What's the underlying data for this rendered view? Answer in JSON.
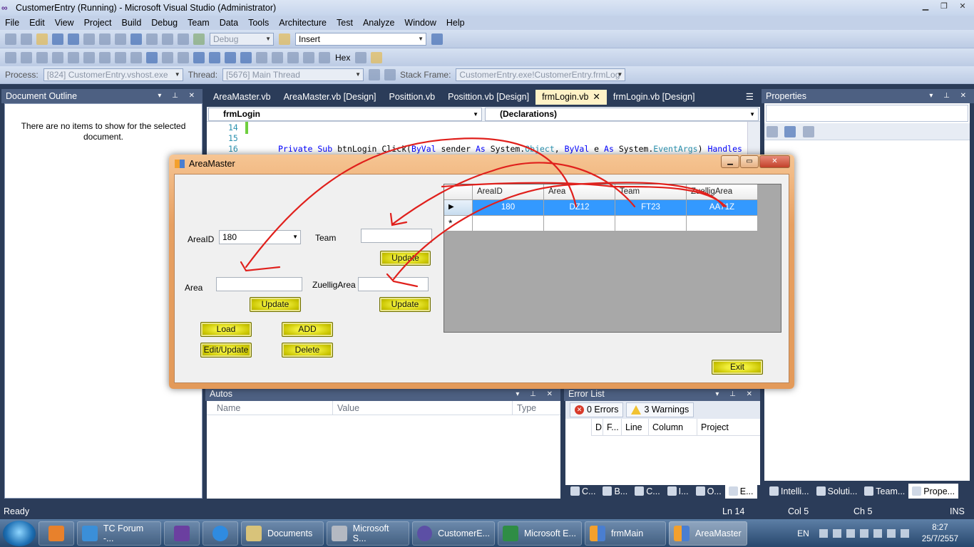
{
  "window": {
    "title": "CustomerEntry (Running) - Microsoft Visual Studio (Administrator)"
  },
  "menu": [
    "File",
    "Edit",
    "View",
    "Project",
    "Build",
    "Debug",
    "Team",
    "Data",
    "Tools",
    "Architecture",
    "Test",
    "Analyze",
    "Window",
    "Help"
  ],
  "toolbar": {
    "config": "Debug",
    "find": "Insert",
    "hex_label": "Hex",
    "process_label": "Process:",
    "process_value": "[824] CustomerEntry.vshost.exe",
    "thread_label": "Thread:",
    "thread_value": "[5676] Main Thread",
    "stack_label": "Stack Frame:",
    "stack_value": "CustomerEntry.exe!CustomerEntry.frmLog"
  },
  "doc_outline": {
    "title": "Document Outline",
    "message": "There are no items to show for the selected document."
  },
  "properties": {
    "title": "Properties"
  },
  "editor": {
    "tabs": [
      {
        "label": "AreaMaster.vb"
      },
      {
        "label": "AreaMaster.vb [Design]"
      },
      {
        "label": "Posittion.vb"
      },
      {
        "label": "Posittion.vb [Design]"
      },
      {
        "label": "frmLogin.vb"
      },
      {
        "label": "frmLogin.vb [Design]"
      }
    ],
    "object_combo": "frmLogin",
    "member_combo": "(Declarations)",
    "lines": [
      "14",
      "15",
      "16"
    ],
    "code_kw1": "Private Sub ",
    "code_name": "btnLogin_Click(",
    "code_kw2": "ByVal",
    "code_p1": " sender ",
    "code_kw3": "As",
    "code_t1": " System.",
    "code_obj": "Object",
    "code_p2": ", ",
    "code_kw4": "ByVal",
    "code_p3": " e ",
    "code_kw5": "As",
    "code_t2": " System.",
    "code_ev": "EventArgs",
    "code_p4": ") ",
    "code_kw6": "Handles"
  },
  "autos": {
    "title": "Autos",
    "col_name": "Name",
    "col_value": "Value",
    "col_type": "Type"
  },
  "error_list": {
    "title": "Error List",
    "errors": "0 Errors",
    "warnings": "3 Warnings",
    "cols": [
      "D",
      "F...",
      "Line",
      "Column",
      "Project"
    ]
  },
  "bottom_tabs_left": [
    "C...",
    "B...",
    "C...",
    "I...",
    "O...",
    "E..."
  ],
  "bottom_tabs_right": [
    "Intelli...",
    "Soluti...",
    "Team...",
    "Prope..."
  ],
  "status": {
    "ready": "Ready",
    "ln": "Ln 14",
    "col": "Col 5",
    "ch": "Ch 5",
    "ins": "INS"
  },
  "dialog": {
    "title": "AreaMaster",
    "areaid_label": "AreaID",
    "areaid_value": "180",
    "team_label": "Team",
    "team_value": "",
    "area_label": "Area",
    "area_value": "",
    "zuellig_label": "ZuelligArea",
    "zuellig_value": "",
    "update_label": "Update",
    "load_label": "Load",
    "add_label": "ADD",
    "edit_label": "Edit/Update",
    "delete_label": "Delete",
    "exit_label": "Exit",
    "grid": {
      "columns": [
        "AreaID",
        "Area",
        "Team",
        "ZuelligArea"
      ],
      "rows": [
        [
          "180",
          "DZ12",
          "FT23",
          "AA71Z"
        ]
      ],
      "new_row_marker": "*",
      "current_row_marker": "▶"
    }
  },
  "taskbar": {
    "items": [
      "TC Forum -...",
      "Documents",
      "Microsoft S...",
      "CustomerE...",
      "Microsoft E...",
      "frmMain",
      "AreaMaster"
    ],
    "lang": "EN",
    "time": "8:27",
    "date": "25/7/2557"
  }
}
